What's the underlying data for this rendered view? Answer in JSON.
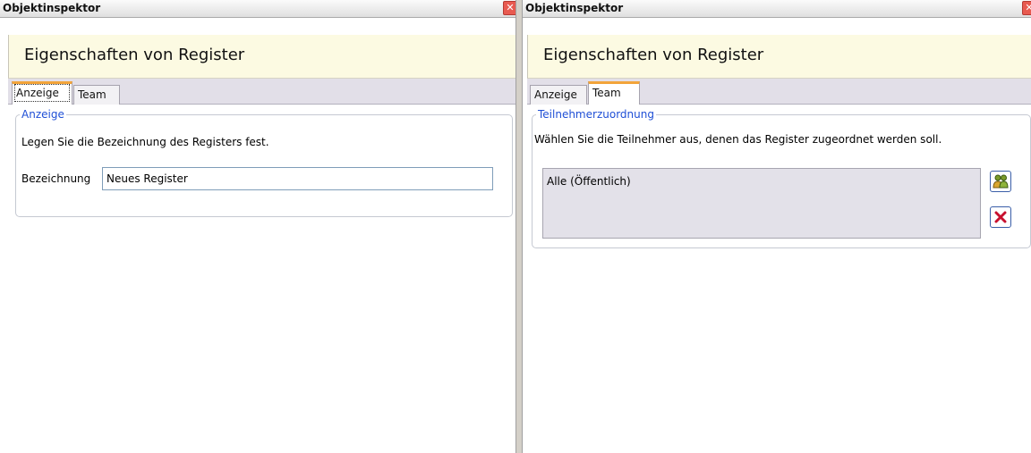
{
  "panels": [
    {
      "title": "Objektinspektor",
      "heading": "Eigenschaften von Register",
      "tabs": [
        {
          "label": "Anzeige",
          "active": true
        },
        {
          "label": "Team",
          "active": false
        }
      ],
      "group": {
        "legend": "Anzeige",
        "description": "Legen Sie die Bezeichnung des Registers fest.",
        "field_label": "Bezeichnung",
        "field_value": "Neues Register"
      }
    },
    {
      "title": "Objektinspektor",
      "heading": "Eigenschaften von Register",
      "tabs": [
        {
          "label": "Anzeige",
          "active": false
        },
        {
          "label": "Team",
          "active": true
        }
      ],
      "group": {
        "legend": "Teilnehmerzuordnung",
        "description": "Wählen Sie die Teilnehmer aus, denen das Register zugeordnet werden soll.",
        "list_items": [
          "Alle (Öffentlich)"
        ],
        "buttons": [
          {
            "icon": "add-participants-icon"
          },
          {
            "icon": "remove-icon"
          }
        ]
      }
    }
  ],
  "close_glyph": "✕",
  "colors": {
    "header_bg": "#fcfae2",
    "tabstrip_bg": "#e2dfe8",
    "active_tab_accent": "#f2a43a",
    "legend_text": "#1f4fd6",
    "close_button": "#e85a50",
    "remove_icon": "#c8102e"
  }
}
